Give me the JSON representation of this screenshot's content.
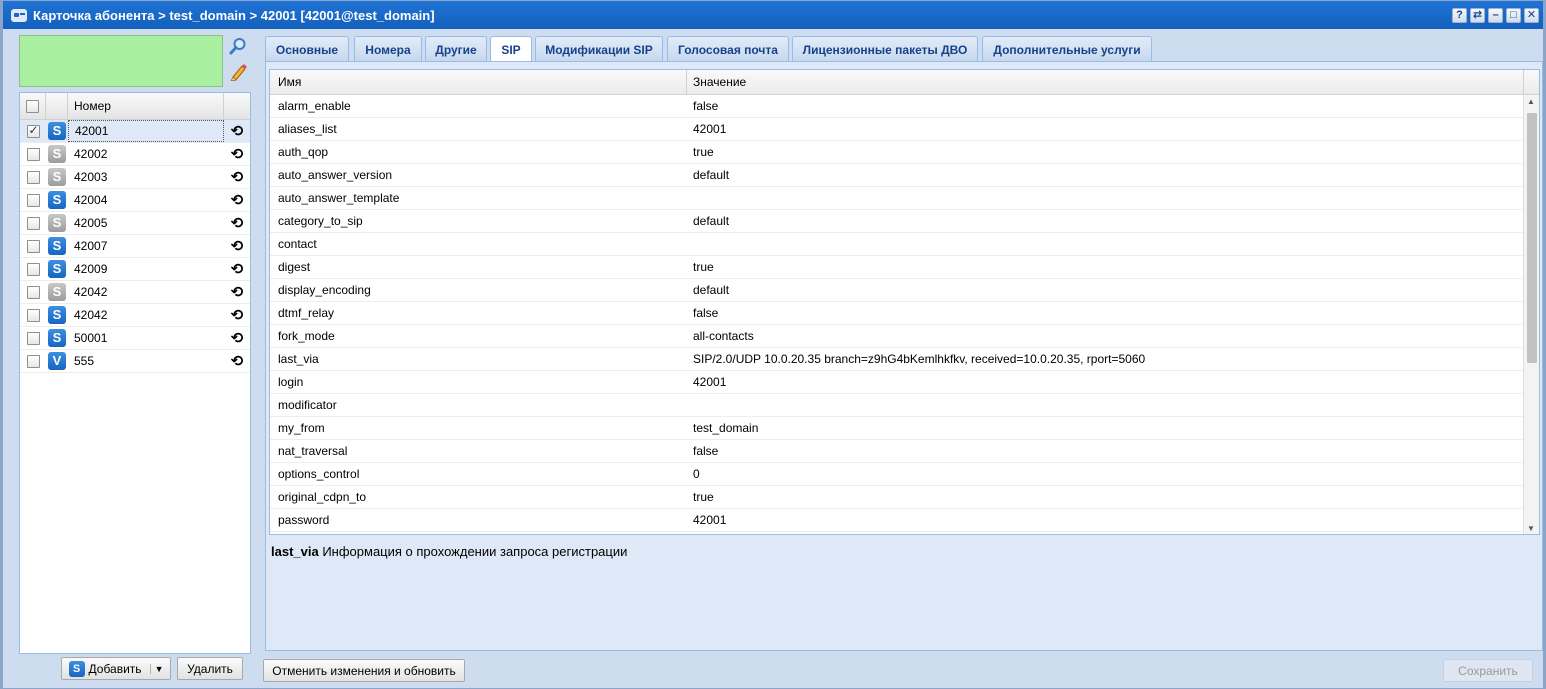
{
  "window": {
    "title": "Карточка абонента > test_domain > 42001 [42001@test_domain]",
    "tools": [
      "?",
      "⇄",
      "–",
      "□",
      "✕"
    ]
  },
  "numbers": {
    "column_header": "Номер",
    "rows": [
      {
        "number": "42001",
        "type": "S",
        "color": "blue",
        "checked": true,
        "selected": true
      },
      {
        "number": "42002",
        "type": "S",
        "color": "gray",
        "checked": false,
        "selected": false
      },
      {
        "number": "42003",
        "type": "S",
        "color": "gray",
        "checked": false,
        "selected": false
      },
      {
        "number": "42004",
        "type": "S",
        "color": "blue",
        "checked": false,
        "selected": false
      },
      {
        "number": "42005",
        "type": "S",
        "color": "gray",
        "checked": false,
        "selected": false
      },
      {
        "number": "42007",
        "type": "S",
        "color": "blue",
        "checked": false,
        "selected": false
      },
      {
        "number": "42009",
        "type": "S",
        "color": "blue",
        "checked": false,
        "selected": false
      },
      {
        "number": "42042",
        "type": "S",
        "color": "gray",
        "checked": false,
        "selected": false
      },
      {
        "number": "42042",
        "type": "S",
        "color": "blue",
        "checked": false,
        "selected": false
      },
      {
        "number": "50001",
        "type": "S",
        "color": "blue",
        "checked": false,
        "selected": false
      },
      {
        "number": "555",
        "type": "V",
        "color": "blue",
        "checked": false,
        "selected": false
      }
    ],
    "add_label": "Добавить",
    "delete_label": "Удалить"
  },
  "tabs": [
    {
      "label": "Основные",
      "active": false
    },
    {
      "label": "Номера",
      "active": false
    },
    {
      "label": "Другие",
      "active": false
    },
    {
      "label": "SIP",
      "active": true
    },
    {
      "label": "Модификации SIP",
      "active": false
    },
    {
      "label": "Голосовая почта",
      "active": false
    },
    {
      "label": "Лицензионные пакеты ДВО",
      "active": false
    },
    {
      "label": "Дополнительные услуги",
      "active": false
    }
  ],
  "properties": {
    "col_name": "Имя",
    "col_value": "Значение",
    "rows": [
      {
        "name": "alarm_enable",
        "value": "false"
      },
      {
        "name": "aliases_list",
        "value": "42001"
      },
      {
        "name": "auth_qop",
        "value": "true"
      },
      {
        "name": "auto_answer_version",
        "value": "default"
      },
      {
        "name": "auto_answer_template",
        "value": ""
      },
      {
        "name": "category_to_sip",
        "value": "default"
      },
      {
        "name": "contact",
        "value": ""
      },
      {
        "name": "digest",
        "value": "true"
      },
      {
        "name": "display_encoding",
        "value": "default"
      },
      {
        "name": "dtmf_relay",
        "value": "false"
      },
      {
        "name": "fork_mode",
        "value": "all-contacts"
      },
      {
        "name": "last_via",
        "value": "SIP/2.0/UDP 10.0.20.35 branch=z9hG4bKemlhkfkv, received=10.0.20.35, rport=5060"
      },
      {
        "name": "login",
        "value": "42001"
      },
      {
        "name": "modificator",
        "value": ""
      },
      {
        "name": "my_from",
        "value": "test_domain"
      },
      {
        "name": "nat_traversal",
        "value": "false"
      },
      {
        "name": "options_control",
        "value": "0"
      },
      {
        "name": "original_cdpn_to",
        "value": "true"
      },
      {
        "name": "password",
        "value": "42001"
      }
    ]
  },
  "description": {
    "key": "last_via",
    "text": "Информация о прохождении запроса регистрации"
  },
  "footer": {
    "cancel_label": "Отменить изменения и обновить",
    "save_label": "Сохранить"
  }
}
